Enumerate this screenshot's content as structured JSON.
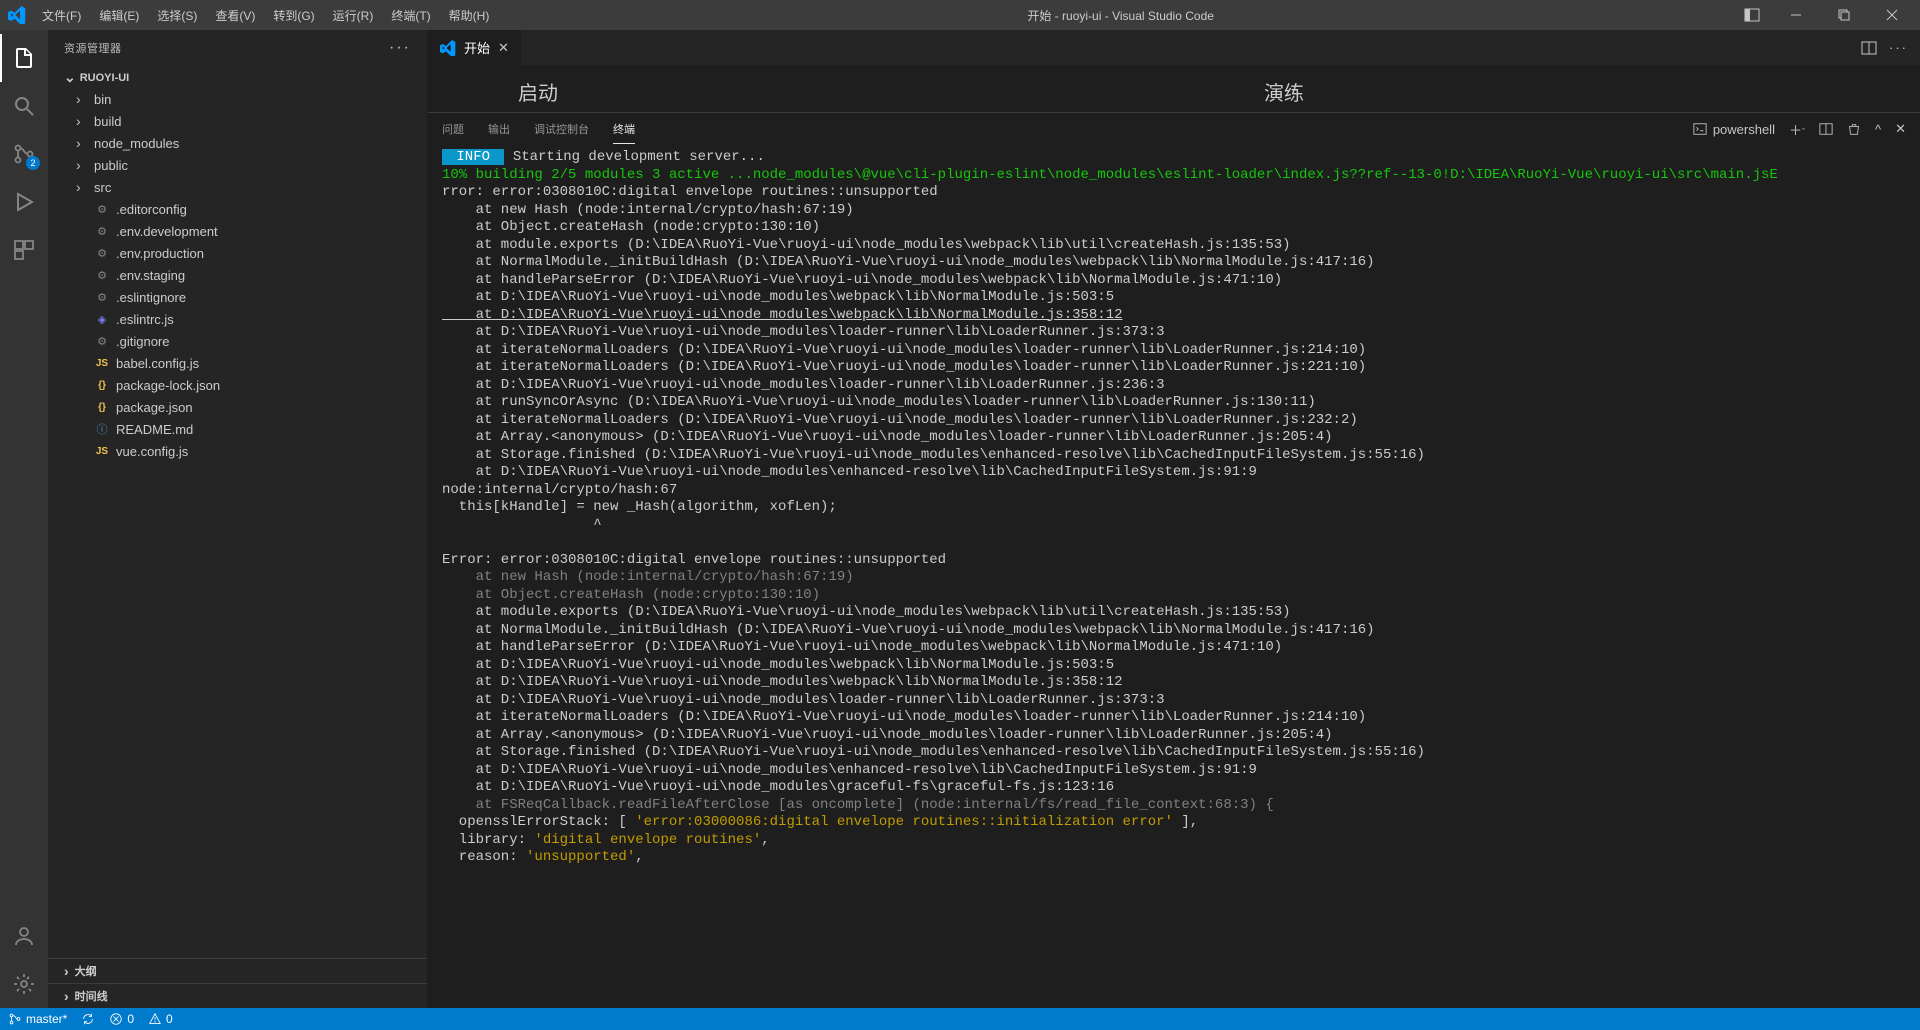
{
  "window": {
    "title": "开始 - ruoyi-ui - Visual Studio Code"
  },
  "menu": {
    "file": "文件(F)",
    "edit": "编辑(E)",
    "select": "选择(S)",
    "view": "查看(V)",
    "goto": "转到(G)",
    "run": "运行(R)",
    "terminal": "终端(T)",
    "help": "帮助(H)"
  },
  "sidebar": {
    "title": "资源管理器",
    "project": "RUOYI-UI",
    "folders": {
      "bin": "bin",
      "build": "build",
      "node_modules": "node_modules",
      "public": "public",
      "src": "src"
    },
    "files": {
      "editorconfig": ".editorconfig",
      "env_dev": ".env.development",
      "env_prod": ".env.production",
      "env_staging": ".env.staging",
      "eslintignore": ".eslintignore",
      "eslintrc": ".eslintrc.js",
      "gitignore": ".gitignore",
      "babel": "babel.config.js",
      "pkglock": "package-lock.json",
      "pkg": "package.json",
      "readme": "README.md",
      "vueconfig": "vue.config.js"
    },
    "outline": "大纲",
    "timeline": "时间线"
  },
  "activity": {
    "scm_badge": "2"
  },
  "tab": {
    "label": "开始"
  },
  "welcome": {
    "start": "启动",
    "walkthrough": "演练"
  },
  "panel": {
    "problems": "问题",
    "output": "输出",
    "debug_console": "调试控制台",
    "terminal": "终端",
    "shell": "powershell"
  },
  "terminal_lines": [
    {
      "cls": "",
      "pre": "badge",
      "text": " Starting development server..."
    },
    {
      "cls": "t-green",
      "text": "10% building 2/5 modules 3 active ...node_modules\\@vue\\cli-plugin-eslint\\node_modules\\eslint-loader\\index.js??ref--13-0!D:\\IDEA\\RuoYi-Vue\\ruoyi-ui\\src\\main.jsE"
    },
    {
      "cls": "",
      "text": "rror: error:0308010C:digital envelope routines::unsupported"
    },
    {
      "cls": "",
      "text": "    at new Hash (node:internal/crypto/hash:67:19)"
    },
    {
      "cls": "",
      "text": "    at Object.createHash (node:crypto:130:10)"
    },
    {
      "cls": "",
      "text": "    at module.exports (D:\\IDEA\\RuoYi-Vue\\ruoyi-ui\\node_modules\\webpack\\lib\\util\\createHash.js:135:53)"
    },
    {
      "cls": "",
      "text": "    at NormalModule._initBuildHash (D:\\IDEA\\RuoYi-Vue\\ruoyi-ui\\node_modules\\webpack\\lib\\NormalModule.js:417:16)"
    },
    {
      "cls": "",
      "text": "    at handleParseError (D:\\IDEA\\RuoYi-Vue\\ruoyi-ui\\node_modules\\webpack\\lib\\NormalModule.js:471:10)"
    },
    {
      "cls": "",
      "text": "    at D:\\IDEA\\RuoYi-Vue\\ruoyi-ui\\node_modules\\webpack\\lib\\NormalModule.js:503:5"
    },
    {
      "cls": "t-underline",
      "text": "    at D:\\IDEA\\RuoYi-Vue\\ruoyi-ui\\node_modules\\webpack\\lib\\NormalModule.js:358:12"
    },
    {
      "cls": "",
      "text": "    at D:\\IDEA\\RuoYi-Vue\\ruoyi-ui\\node_modules\\loader-runner\\lib\\LoaderRunner.js:373:3"
    },
    {
      "cls": "",
      "text": "    at iterateNormalLoaders (D:\\IDEA\\RuoYi-Vue\\ruoyi-ui\\node_modules\\loader-runner\\lib\\LoaderRunner.js:214:10)"
    },
    {
      "cls": "",
      "text": "    at iterateNormalLoaders (D:\\IDEA\\RuoYi-Vue\\ruoyi-ui\\node_modules\\loader-runner\\lib\\LoaderRunner.js:221:10)"
    },
    {
      "cls": "",
      "text": "    at D:\\IDEA\\RuoYi-Vue\\ruoyi-ui\\node_modules\\loader-runner\\lib\\LoaderRunner.js:236:3"
    },
    {
      "cls": "",
      "text": "    at runSyncOrAsync (D:\\IDEA\\RuoYi-Vue\\ruoyi-ui\\node_modules\\loader-runner\\lib\\LoaderRunner.js:130:11)"
    },
    {
      "cls": "",
      "text": "    at iterateNormalLoaders (D:\\IDEA\\RuoYi-Vue\\ruoyi-ui\\node_modules\\loader-runner\\lib\\LoaderRunner.js:232:2)"
    },
    {
      "cls": "",
      "text": "    at Array.<anonymous> (D:\\IDEA\\RuoYi-Vue\\ruoyi-ui\\node_modules\\loader-runner\\lib\\LoaderRunner.js:205:4)"
    },
    {
      "cls": "",
      "text": "    at Storage.finished (D:\\IDEA\\RuoYi-Vue\\ruoyi-ui\\node_modules\\enhanced-resolve\\lib\\CachedInputFileSystem.js:55:16)"
    },
    {
      "cls": "",
      "text": "    at D:\\IDEA\\RuoYi-Vue\\ruoyi-ui\\node_modules\\enhanced-resolve\\lib\\CachedInputFileSystem.js:91:9"
    },
    {
      "cls": "",
      "text": "node:internal/crypto/hash:67"
    },
    {
      "cls": "",
      "text": "  this[kHandle] = new _Hash(algorithm, xofLen);"
    },
    {
      "cls": "",
      "text": "                  ^"
    },
    {
      "cls": "",
      "text": ""
    },
    {
      "cls": "",
      "text": "Error: error:0308010C:digital envelope routines::unsupported"
    },
    {
      "cls": "t-gray",
      "text": "    at new Hash (node:internal/crypto/hash:67:19)"
    },
    {
      "cls": "t-gray",
      "text": "    at Object.createHash (node:crypto:130:10)"
    },
    {
      "cls": "",
      "text": "    at module.exports (D:\\IDEA\\RuoYi-Vue\\ruoyi-ui\\node_modules\\webpack\\lib\\util\\createHash.js:135:53)"
    },
    {
      "cls": "",
      "text": "    at NormalModule._initBuildHash (D:\\IDEA\\RuoYi-Vue\\ruoyi-ui\\node_modules\\webpack\\lib\\NormalModule.js:417:16)"
    },
    {
      "cls": "",
      "text": "    at handleParseError (D:\\IDEA\\RuoYi-Vue\\ruoyi-ui\\node_modules\\webpack\\lib\\NormalModule.js:471:10)"
    },
    {
      "cls": "",
      "text": "    at D:\\IDEA\\RuoYi-Vue\\ruoyi-ui\\node_modules\\webpack\\lib\\NormalModule.js:503:5"
    },
    {
      "cls": "",
      "text": "    at D:\\IDEA\\RuoYi-Vue\\ruoyi-ui\\node_modules\\webpack\\lib\\NormalModule.js:358:12"
    },
    {
      "cls": "",
      "text": "    at D:\\IDEA\\RuoYi-Vue\\ruoyi-ui\\node_modules\\loader-runner\\lib\\LoaderRunner.js:373:3"
    },
    {
      "cls": "",
      "text": "    at iterateNormalLoaders (D:\\IDEA\\RuoYi-Vue\\ruoyi-ui\\node_modules\\loader-runner\\lib\\LoaderRunner.js:214:10)"
    },
    {
      "cls": "",
      "text": "    at Array.<anonymous> (D:\\IDEA\\RuoYi-Vue\\ruoyi-ui\\node_modules\\loader-runner\\lib\\LoaderRunner.js:205:4)"
    },
    {
      "cls": "",
      "text": "    at Storage.finished (D:\\IDEA\\RuoYi-Vue\\ruoyi-ui\\node_modules\\enhanced-resolve\\lib\\CachedInputFileSystem.js:55:16)"
    },
    {
      "cls": "",
      "text": "    at D:\\IDEA\\RuoYi-Vue\\ruoyi-ui\\node_modules\\enhanced-resolve\\lib\\CachedInputFileSystem.js:91:9"
    },
    {
      "cls": "",
      "text": "    at D:\\IDEA\\RuoYi-Vue\\ruoyi-ui\\node_modules\\graceful-fs\\graceful-fs.js:123:16"
    },
    {
      "cls": "t-gray",
      "text": "    at FSReqCallback.readFileAfterClose [as oncomplete] (node:internal/fs/read_file_context:68:3) {"
    },
    {
      "cls": "mixed1",
      "text": ""
    },
    {
      "cls": "mixed2",
      "text": ""
    },
    {
      "cls": "mixed3",
      "text": ""
    }
  ],
  "terminal_mixed": {
    "line1_a": "  opensslErrorStack: [ ",
    "line1_b": "'error:03000086:digital envelope routines::initialization error'",
    "line1_c": " ],",
    "line2_a": "  library: ",
    "line2_b": "'digital envelope routines'",
    "line2_c": ",",
    "line3_a": "  reason: ",
    "line3_b": "'unsupported'",
    "line3_c": ","
  },
  "info_badge": " INFO ",
  "status": {
    "branch": "master*",
    "sync": "",
    "errors": "0",
    "warnings": "0"
  }
}
